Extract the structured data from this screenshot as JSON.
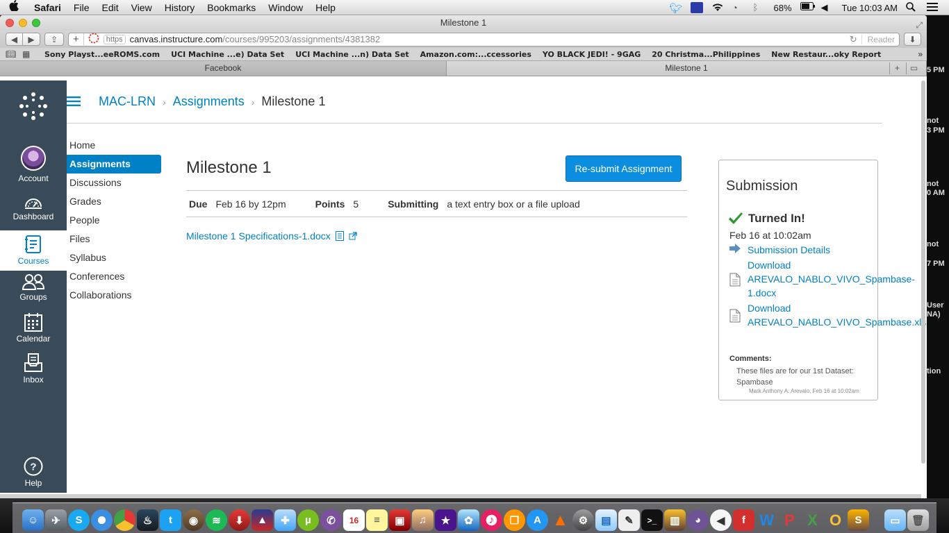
{
  "menubar": {
    "apple": "",
    "app_name": "Safari",
    "items": [
      "File",
      "Edit",
      "View",
      "History",
      "Bookmarks",
      "Window",
      "Help"
    ],
    "battery": "68%",
    "clock": "Tue 10:03 AM"
  },
  "window": {
    "title": "Milestone 1"
  },
  "toolbar": {
    "back": "◀",
    "forward": "▶",
    "share": "⇪",
    "new_tab": "+",
    "url_scheme": "https",
    "url_host": "canvas.instructure.com",
    "url_path": "/courses/995203/assignments/4381382",
    "reader": "Reader",
    "reload": "↻",
    "download": "⬇"
  },
  "bookmarks": {
    "items": [
      "Sony Playst...eeROMS.com",
      "UCI Machine ...e) Data Set",
      "UCI Machine ...n) Data Set",
      "Amazon.com:...ccessories",
      "YO BLACK JEDI! - 9GAG",
      "20 Christma...Philippines",
      "New Restaur...oky Report"
    ],
    "more": "»"
  },
  "tabs": [
    {
      "label": "Facebook"
    },
    {
      "label": "Milestone 1"
    }
  ],
  "desktop_strip": [
    "not",
    "5 PM",
    "not",
    "3 PM",
    "not",
    "0 AM",
    "not",
    "7 PM",
    "User",
    "NA)",
    "tion"
  ],
  "global_nav": {
    "items": [
      {
        "label": "Account",
        "icon": "account-avatar"
      },
      {
        "label": "Dashboard",
        "icon": "dashboard-icon"
      },
      {
        "label": "Courses",
        "icon": "courses-icon"
      },
      {
        "label": "Groups",
        "icon": "groups-icon"
      },
      {
        "label": "Calendar",
        "icon": "calendar-icon"
      },
      {
        "label": "Inbox",
        "icon": "inbox-icon"
      },
      {
        "label": "Help",
        "icon": "help-icon"
      }
    ],
    "active_color": "#0081c6",
    "bg_color": "#394b58"
  },
  "breadcrumb": {
    "course": "MAC-LRN",
    "section": "Assignments",
    "current": "Milestone 1",
    "separator": "›"
  },
  "course_nav": {
    "items": [
      "Home",
      "Assignments",
      "Discussions",
      "Grades",
      "People",
      "Files",
      "Syllabus",
      "Conferences",
      "Collaborations"
    ],
    "active": "Assignments"
  },
  "assignment": {
    "title": "Milestone 1",
    "resubmit_label": "Re-submit Assignment",
    "due_label": "Due",
    "due_value": "Feb 16 by 12pm",
    "points_label": "Points",
    "points_value": "5",
    "submitting_label": "Submitting",
    "submitting_value": "a text entry box or a file upload",
    "attachment": "Milestone 1 Specifications-1.docx"
  },
  "submission": {
    "heading": "Submission",
    "status": "Turned In!",
    "date": "Feb 16 at 10:02am",
    "details_link": "Submission Details",
    "download_1_line1": "Download",
    "download_1_line2": "AREVALO_NABLO_VIVO_Spambase-",
    "download_1_line3": "1.docx",
    "download_2_line1": "Download",
    "download_2_line2": "AREVALO_NABLO_VIVO_Spambase.xlsx",
    "comments_label": "Comments:",
    "comment_text": "These files are for our 1st Dataset: Spambase",
    "comment_author": "Mark Anthony A. Arevalo, Feb 16 at 10:02am"
  }
}
